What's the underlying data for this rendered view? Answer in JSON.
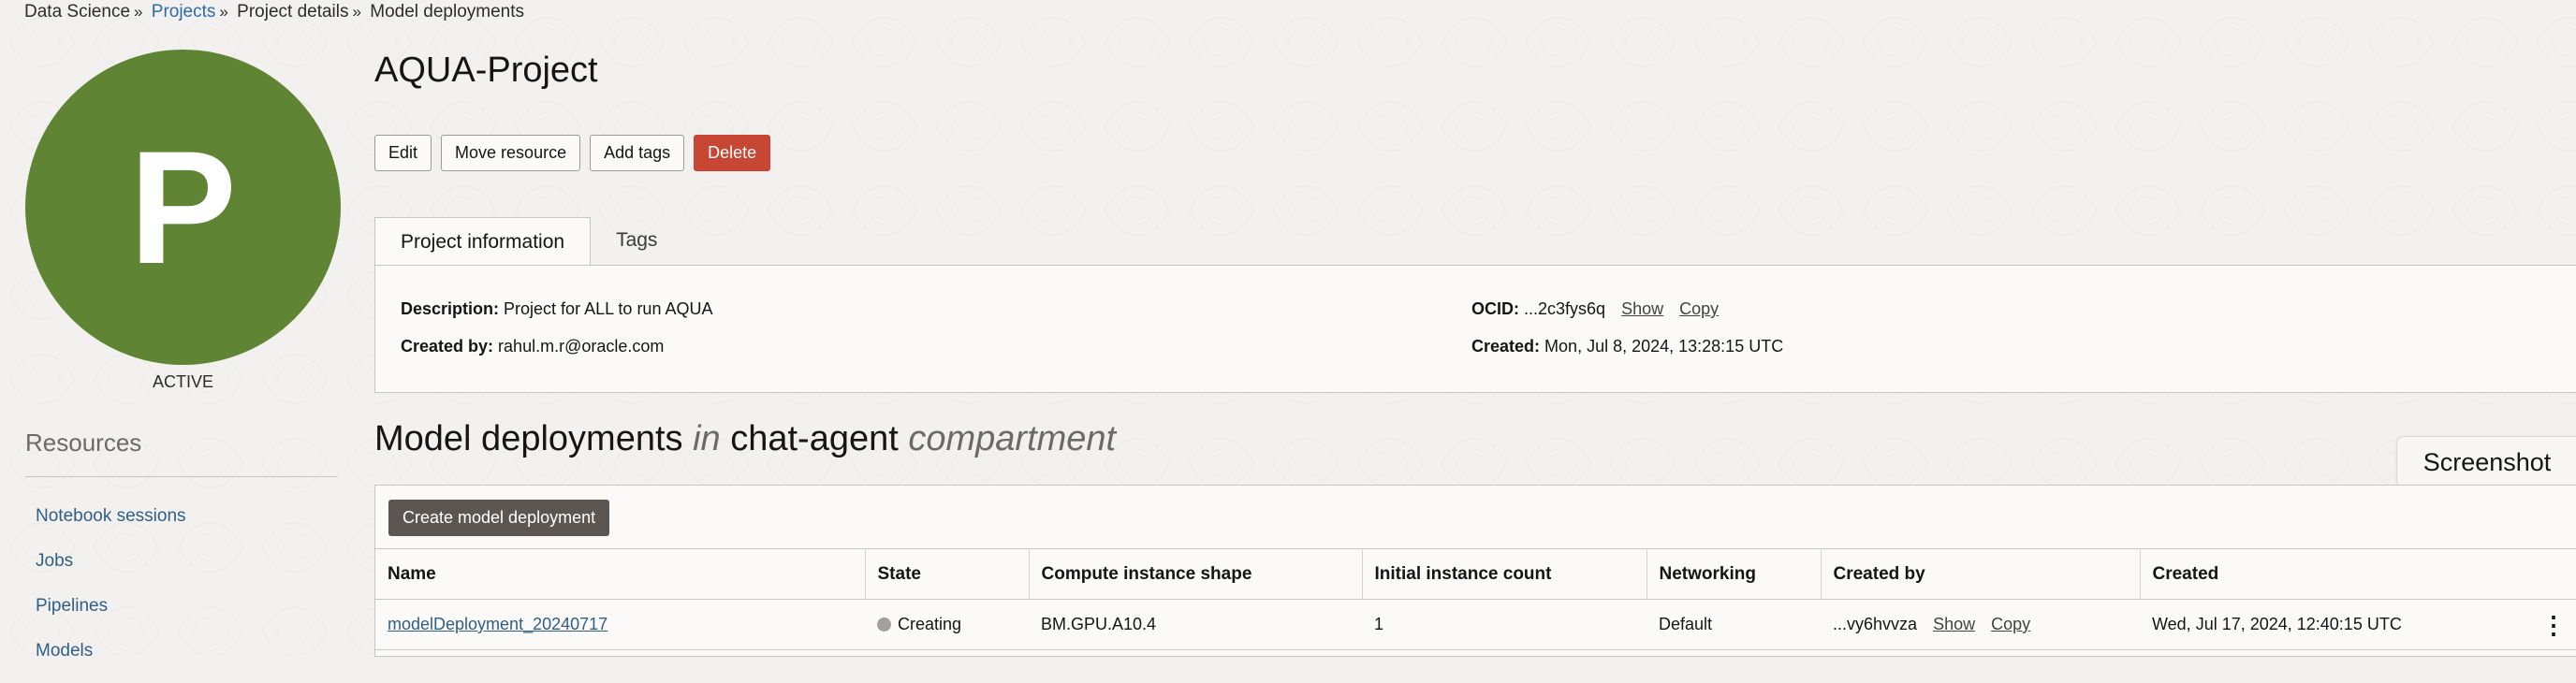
{
  "breadcrumb": {
    "items": [
      "Data Science",
      "Projects",
      "Project details",
      "Model deployments"
    ],
    "separator": "»"
  },
  "avatar": {
    "letter": "P",
    "status": "ACTIVE",
    "color": "#5e8434"
  },
  "resources": {
    "title": "Resources",
    "items": [
      "Notebook sessions",
      "Jobs",
      "Pipelines",
      "Models"
    ]
  },
  "project": {
    "title": "AQUA-Project",
    "actions": {
      "edit": "Edit",
      "move": "Move resource",
      "add_tags": "Add tags",
      "delete": "Delete"
    }
  },
  "tabs": {
    "info": "Project information",
    "tags": "Tags"
  },
  "info": {
    "description_label": "Description:",
    "description": "Project for ALL to run AQUA",
    "created_by_label": "Created by:",
    "created_by": "rahul.m.r@oracle.com",
    "ocid_label": "OCID:",
    "ocid": "...2c3fys6q",
    "show": "Show",
    "copy": "Copy",
    "created_label": "Created:",
    "created": "Mon, Jul 8, 2024, 13:28:15 UTC"
  },
  "section": {
    "title": "Model deployments",
    "in": "in",
    "compartment_name": "chat-agent",
    "compartment": "compartment"
  },
  "screenshot_label": "Screenshot",
  "table": {
    "create_button": "Create model deployment",
    "headers": [
      "Name",
      "State",
      "Compute instance shape",
      "Initial instance count",
      "Networking",
      "Created by",
      "Created"
    ],
    "rows": [
      {
        "name": "modelDeployment_20240717",
        "state": "Creating",
        "shape": "BM.GPU.A10.4",
        "count": "1",
        "networking": "Default",
        "created_by": "...vy6hvvza",
        "show": "Show",
        "copy": "Copy",
        "created": "Wed, Jul 17, 2024, 12:40:15 UTC"
      }
    ]
  },
  "colors": {
    "danger": "#c74634",
    "link": "#2f5e87",
    "state_creating": "#a3a09b"
  }
}
